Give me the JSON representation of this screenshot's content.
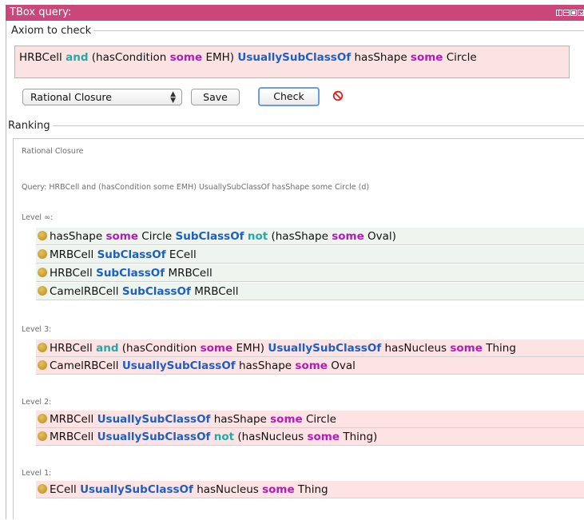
{
  "window": {
    "title": "TBox query:"
  },
  "axiom_group": {
    "legend": "Axiom to check",
    "input_tokens": [
      {
        "t": "HRBCell ",
        "s": "plain"
      },
      {
        "t": "and",
        "s": "teal"
      },
      {
        "t": " (hasCondition ",
        "s": "plain"
      },
      {
        "t": "some",
        "s": "purple"
      },
      {
        "t": " EMH) ",
        "s": "plain"
      },
      {
        "t": "UsuallySubClassOf",
        "s": "blue"
      },
      {
        "t": " hasShape ",
        "s": "plain"
      },
      {
        "t": "some",
        "s": "purple"
      },
      {
        "t": " Circle",
        "s": "plain"
      }
    ],
    "closure_select": {
      "value": "Rational Closure"
    },
    "save_label": "Save",
    "check_label": "Check"
  },
  "ranking": {
    "legend": "Ranking",
    "header": "Rational Closure",
    "query": "Query: HRBCell and (hasCondition some EMH) UsuallySubClassOf hasShape some Circle (d)",
    "levels": [
      {
        "label": "Level ∞:",
        "color": "green",
        "rows": [
          [
            {
              "t": "hasShape ",
              "s": "plain"
            },
            {
              "t": "some",
              "s": "purple"
            },
            {
              "t": " Circle ",
              "s": "plain"
            },
            {
              "t": "SubClassOf",
              "s": "blue"
            },
            {
              "t": " ",
              "s": "plain"
            },
            {
              "t": "not",
              "s": "teal"
            },
            {
              "t": " (hasShape ",
              "s": "plain"
            },
            {
              "t": "some",
              "s": "purple"
            },
            {
              "t": " Oval)",
              "s": "plain"
            }
          ],
          [
            {
              "t": "MRBCell ",
              "s": "plain"
            },
            {
              "t": "SubClassOf",
              "s": "blue"
            },
            {
              "t": " ECell",
              "s": "plain"
            }
          ],
          [
            {
              "t": "HRBCell ",
              "s": "plain"
            },
            {
              "t": "SubClassOf",
              "s": "blue"
            },
            {
              "t": " MRBCell",
              "s": "plain"
            }
          ],
          [
            {
              "t": "CamelRBCell ",
              "s": "plain"
            },
            {
              "t": "SubClassOf",
              "s": "blue"
            },
            {
              "t": " MRBCell",
              "s": "plain"
            }
          ]
        ]
      },
      {
        "label": "Level 3:",
        "color": "pink",
        "rows": [
          [
            {
              "t": "HRBCell ",
              "s": "plain"
            },
            {
              "t": "and",
              "s": "teal"
            },
            {
              "t": " (hasCondition ",
              "s": "plain"
            },
            {
              "t": "some",
              "s": "purple"
            },
            {
              "t": " EMH) ",
              "s": "plain"
            },
            {
              "t": "UsuallySubClassOf",
              "s": "blue"
            },
            {
              "t": " hasNucleus ",
              "s": "plain"
            },
            {
              "t": "some",
              "s": "purple"
            },
            {
              "t": " Thing",
              "s": "plain"
            }
          ],
          [
            {
              "t": "CamelRBCell ",
              "s": "plain"
            },
            {
              "t": "UsuallySubClassOf",
              "s": "blue"
            },
            {
              "t": " hasShape ",
              "s": "plain"
            },
            {
              "t": "some",
              "s": "purple"
            },
            {
              "t": " Oval",
              "s": "plain"
            }
          ]
        ]
      },
      {
        "label": "Level 2:",
        "color": "pink",
        "rows": [
          [
            {
              "t": "MRBCell ",
              "s": "plain"
            },
            {
              "t": "UsuallySubClassOf",
              "s": "blue"
            },
            {
              "t": " hasShape ",
              "s": "plain"
            },
            {
              "t": "some",
              "s": "purple"
            },
            {
              "t": " Circle",
              "s": "plain"
            }
          ],
          [
            {
              "t": "MRBCell ",
              "s": "plain"
            },
            {
              "t": "UsuallySubClassOf",
              "s": "blue"
            },
            {
              "t": " ",
              "s": "plain"
            },
            {
              "t": "not",
              "s": "teal"
            },
            {
              "t": " (hasNucleus ",
              "s": "plain"
            },
            {
              "t": "some",
              "s": "purple"
            },
            {
              "t": " Thing)",
              "s": "plain"
            }
          ]
        ]
      },
      {
        "label": "Level 1:",
        "color": "pink",
        "rows": [
          [
            {
              "t": "ECell ",
              "s": "plain"
            },
            {
              "t": "UsuallySubClassOf",
              "s": "blue"
            },
            {
              "t": " hasNucleus ",
              "s": "plain"
            },
            {
              "t": "some",
              "s": "purple"
            },
            {
              "t": " Thing",
              "s": "plain"
            }
          ]
        ]
      }
    ]
  },
  "icons": {
    "window_controls": [
      "restore-icon",
      "minimize-icon",
      "maximize-icon",
      "close-icon"
    ],
    "cancel": "prohibited-icon"
  },
  "colors": {
    "titlebar": "#c9477a",
    "keyword_blue": "#1e5fc2",
    "keyword_purple": "#b41bb9",
    "keyword_teal": "#22a9a9",
    "row_green": "#eef4ee",
    "row_pink": "#fde3e3",
    "input_bg": "#fce3e3"
  }
}
